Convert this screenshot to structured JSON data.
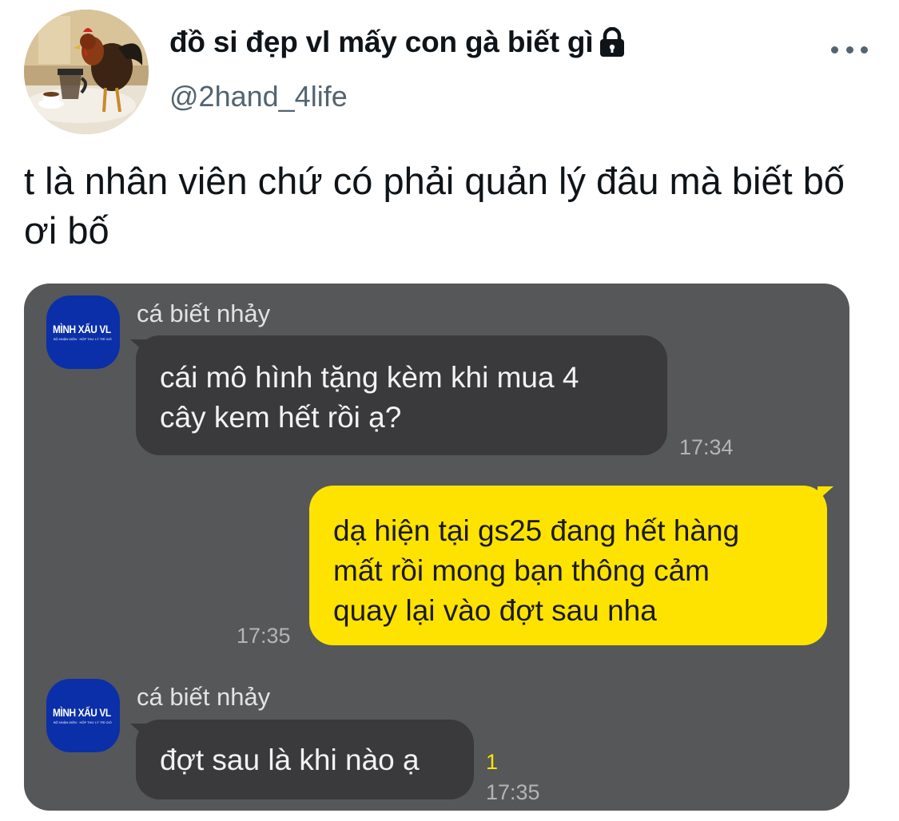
{
  "tweet": {
    "display_name": "đồ si đẹp vl mấy con gà biết gì",
    "handle": "@2hand_4life",
    "text": "t là nhân viên chứ có phải quản lý đâu mà biết bố ơi bố",
    "icons": {
      "avatar": "rooster-avatar",
      "protected": "lock-icon",
      "more": "more-options-icon"
    }
  },
  "chat": {
    "contact_avatar": {
      "logo_text": "MÌNH XẤU VL",
      "logo_subtext": "BỘ NHẬN DIỆN · HỘP THƯ LÝ TRÍ GIÓ",
      "color": "#0b2fa8"
    },
    "messages": [
      {
        "direction": "in",
        "sender": "cá biết nhảy",
        "lines": [
          "cái mô hình tặng kèm khi mua 4",
          "cây kem hết rồi ạ?"
        ],
        "time": "17:34"
      },
      {
        "direction": "out",
        "lines": [
          "dạ hiện tại gs25 đang hết hàng",
          "mất rồi mong bạn thông cảm",
          "quay lại vào đợt sau nha"
        ],
        "time": "17:35"
      },
      {
        "direction": "in",
        "sender": "cá biết nhảy",
        "lines": [
          "đợt sau là khi nào ạ"
        ],
        "time": "17:35",
        "unread": "1"
      }
    ],
    "colors": {
      "background": "#565759",
      "incoming_bubble": "#3a3a3c",
      "outgoing_bubble": "#ffe300"
    }
  }
}
